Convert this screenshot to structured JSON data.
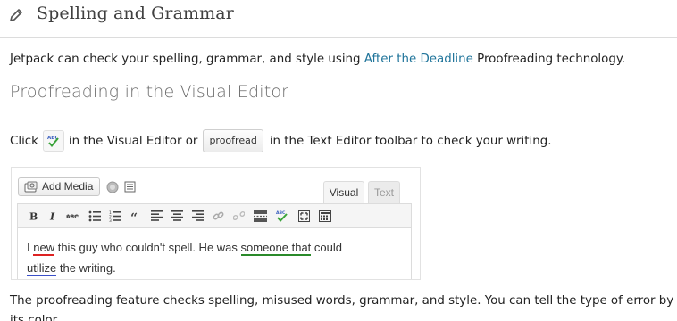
{
  "header": {
    "title": "Spelling and Grammar",
    "icon": "pencil-icon"
  },
  "intro": {
    "before": "Jetpack can check your spelling, grammar, and style using ",
    "link": "After the Deadline",
    "after": " Proofreading technology."
  },
  "subheading": "Proofreading in the Visual Editor",
  "click_line": {
    "t1": "Click",
    "t2": "in the Visual Editor or",
    "button": "proofread",
    "t3": "in the Text Editor toolbar to check your writing."
  },
  "editor": {
    "add_media": "Add Media",
    "tabs": [
      "Visual",
      "Text"
    ],
    "active_tab": "Visual",
    "toolbar_icons": [
      "bold-icon",
      "italic-icon",
      "strikethrough-icon",
      "bullet-list-icon",
      "numbered-list-icon",
      "blockquote-icon",
      "align-left-icon",
      "align-center-icon",
      "align-right-icon",
      "link-icon",
      "unlink-icon",
      "more-icon",
      "proofread-icon",
      "fullscreen-icon",
      "kitchen-sink-icon"
    ],
    "content": {
      "w1": "I ",
      "w2": "new",
      "w3": " this guy who couldn't spell. He was ",
      "w4": "someone that",
      "w5": " could",
      "w6": "utilize",
      "w7": " the writing."
    },
    "error_colors": {
      "spelling": "#d22222",
      "grammar": "#2a8a2a",
      "style": "#3b4fc8"
    }
  },
  "bottom_text": "The proofreading feature checks spelling, misused words, grammar, and style. You can tell the type of error by its color."
}
